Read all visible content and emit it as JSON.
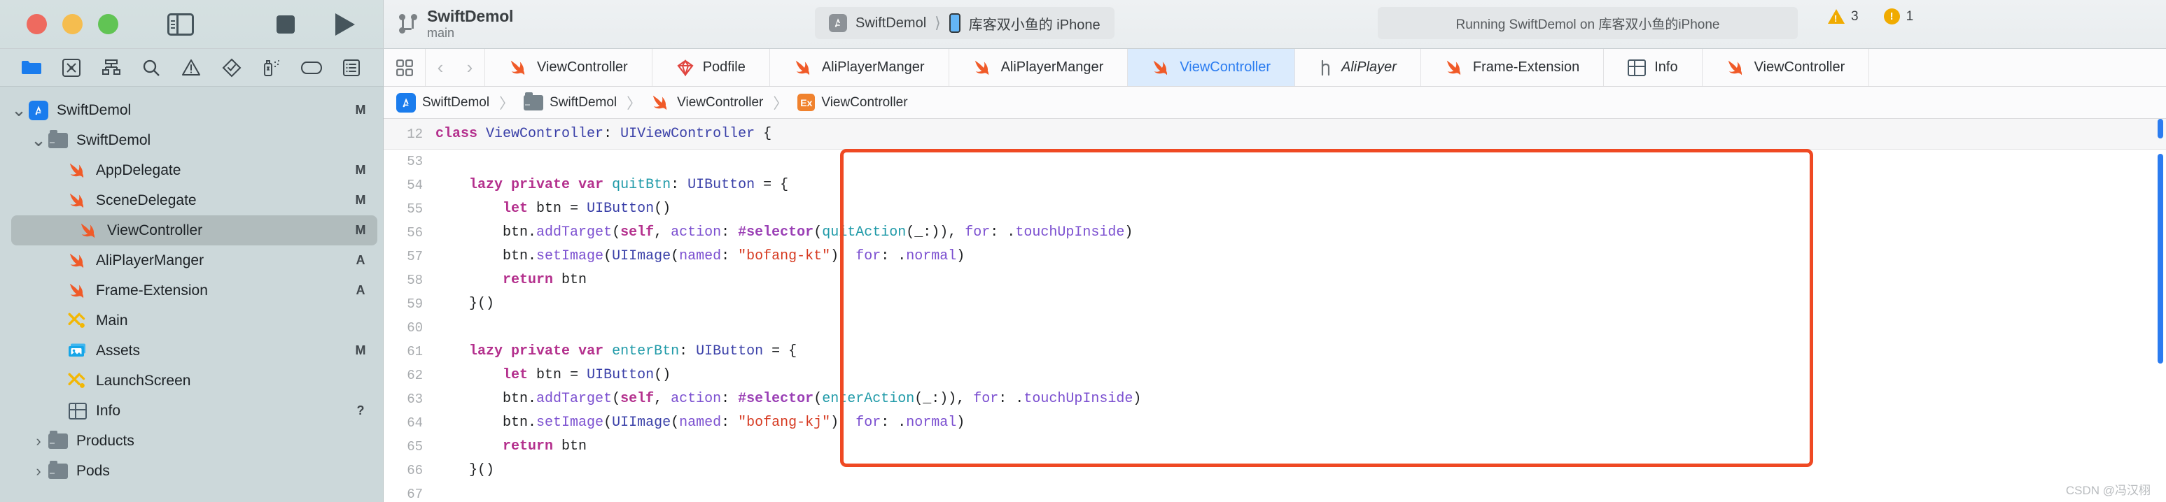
{
  "window": {
    "traffic_lights": [
      "close",
      "minimize",
      "zoom"
    ],
    "sidebar_toggle_icon": "sidebar-toggle-icon",
    "stop_button_icon": "stop-icon",
    "run_button_icon": "play-icon"
  },
  "toolbar": {
    "project_title": "SwiftDemol",
    "branch": "main",
    "scheme": "SwiftDemol",
    "device": "库客双小鱼的 iPhone",
    "activity_status": "Running SwiftDemol on 库客双小鱼的iPhone",
    "warnings_count": "3",
    "issues_count": "1"
  },
  "navigator": {
    "toolbar_icons": [
      "folder-icon",
      "source-control-icon",
      "symbol-hierarchy-icon",
      "search-icon",
      "issue-warning-icon",
      "test-diamond-icon",
      "debug-spray-icon",
      "breakpoint-tag-icon",
      "report-list-icon"
    ],
    "items": [
      {
        "label": "SwiftDemol",
        "icon": "app-project-icon",
        "indent": 0,
        "twisty": "down",
        "status": "M",
        "selected": false
      },
      {
        "label": "SwiftDemol",
        "icon": "folder-icon",
        "indent": 1,
        "twisty": "down",
        "status": "",
        "selected": false
      },
      {
        "label": "AppDelegate",
        "icon": "swift-icon",
        "indent": 2,
        "twisty": "",
        "status": "M",
        "selected": false
      },
      {
        "label": "SceneDelegate",
        "icon": "swift-icon",
        "indent": 2,
        "twisty": "",
        "status": "M",
        "selected": false
      },
      {
        "label": "ViewController",
        "icon": "swift-icon",
        "indent": 2,
        "twisty": "",
        "status": "M",
        "selected": true
      },
      {
        "label": "AliPlayerManger",
        "icon": "swift-icon",
        "indent": 2,
        "twisty": "",
        "status": "A",
        "selected": false
      },
      {
        "label": "Frame-Extension",
        "icon": "swift-icon",
        "indent": 2,
        "twisty": "",
        "status": "A",
        "selected": false
      },
      {
        "label": "Main",
        "icon": "storyboard-icon",
        "indent": 2,
        "twisty": "",
        "status": "",
        "selected": false
      },
      {
        "label": "Assets",
        "icon": "assets-icon",
        "indent": 2,
        "twisty": "",
        "status": "M",
        "selected": false
      },
      {
        "label": "LaunchScreen",
        "icon": "storyboard-icon",
        "indent": 2,
        "twisty": "",
        "status": "",
        "selected": false
      },
      {
        "label": "Info",
        "icon": "plist-icon",
        "indent": 2,
        "twisty": "",
        "status": "?",
        "selected": false
      },
      {
        "label": "Products",
        "icon": "folder-icon",
        "indent": 1,
        "twisty": "right",
        "status": "",
        "selected": false
      },
      {
        "label": "Pods",
        "icon": "folder-icon",
        "indent": 1,
        "twisty": "right",
        "status": "",
        "selected": false
      }
    ]
  },
  "editor": {
    "tabs": [
      {
        "label": "ViewController",
        "icon": "swift-icon",
        "active": false,
        "italic": false
      },
      {
        "label": "Podfile",
        "icon": "ruby-icon",
        "active": false,
        "italic": false
      },
      {
        "label": "AliPlayerManger",
        "icon": "swift-icon",
        "active": false,
        "italic": false
      },
      {
        "label": "AliPlayerManger",
        "icon": "swift-icon",
        "active": false,
        "italic": false
      },
      {
        "label": "ViewController",
        "icon": "swift-icon",
        "active": true,
        "italic": false
      },
      {
        "label": "AliPlayer",
        "icon": "header-icon",
        "active": false,
        "italic": true
      },
      {
        "label": "Frame-Extension",
        "icon": "swift-icon",
        "active": false,
        "italic": false
      },
      {
        "label": "Info",
        "icon": "plist-icon",
        "active": false,
        "italic": false
      },
      {
        "label": "ViewController",
        "icon": "swift-icon",
        "active": false,
        "italic": false
      }
    ],
    "breadcrumb": [
      {
        "label": "SwiftDemol",
        "icon": "app-project-icon"
      },
      {
        "label": "SwiftDemol",
        "icon": "folder-icon"
      },
      {
        "label": "ViewController",
        "icon": "swift-icon"
      },
      {
        "label": "ViewController",
        "icon": "extension-badge-icon"
      }
    ],
    "pinned_line": {
      "number": "12",
      "text": "class ViewController: UIViewController {"
    },
    "lines": [
      {
        "number": "53",
        "text": ""
      },
      {
        "number": "54",
        "text": "    lazy private var quitBtn: UIButton = {"
      },
      {
        "number": "55",
        "text": "        let btn = UIButton()"
      },
      {
        "number": "56",
        "text": "        btn.addTarget(self, action: #selector(quitAction(_:)), for: .touchUpInside)"
      },
      {
        "number": "57",
        "text": "        btn.setImage(UIImage(named: \"bofang-kt\"), for: .normal)"
      },
      {
        "number": "58",
        "text": "        return btn"
      },
      {
        "number": "59",
        "text": "    }()"
      },
      {
        "number": "60",
        "text": ""
      },
      {
        "number": "61",
        "text": "    lazy private var enterBtn: UIButton = {"
      },
      {
        "number": "62",
        "text": "        let btn = UIButton()"
      },
      {
        "number": "63",
        "text": "        btn.addTarget(self, action: #selector(enterAction(_:)), for: .touchUpInside)"
      },
      {
        "number": "64",
        "text": "        btn.setImage(UIImage(named: \"bofang-kj\"), for: .normal)"
      },
      {
        "number": "65",
        "text": "        return btn"
      },
      {
        "number": "66",
        "text": "    }()"
      },
      {
        "number": "67",
        "text": ""
      }
    ],
    "highlight_color": "#ef4923"
  },
  "watermark": "CSDN @冯汉栩"
}
